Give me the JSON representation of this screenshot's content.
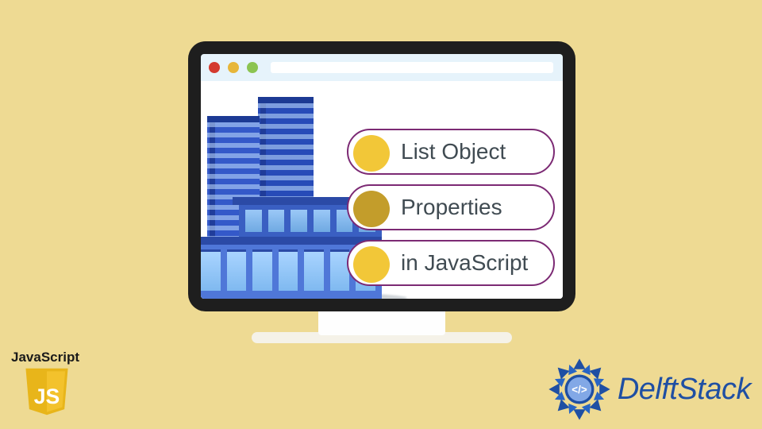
{
  "pills": [
    {
      "label": "List Object"
    },
    {
      "label": "Properties"
    },
    {
      "label": "in JavaScript"
    }
  ],
  "js": {
    "title": "JavaScript",
    "shield_text": "JS"
  },
  "brand": {
    "name": "DelftStack",
    "code_glyph": "</>"
  },
  "colors": {
    "page_bg": "#eeda93",
    "pill_border": "#7c2a74",
    "pill_bullet": "#f2c738",
    "brand_blue": "#1f4fa3",
    "js_yellow": "#f3c22c"
  }
}
